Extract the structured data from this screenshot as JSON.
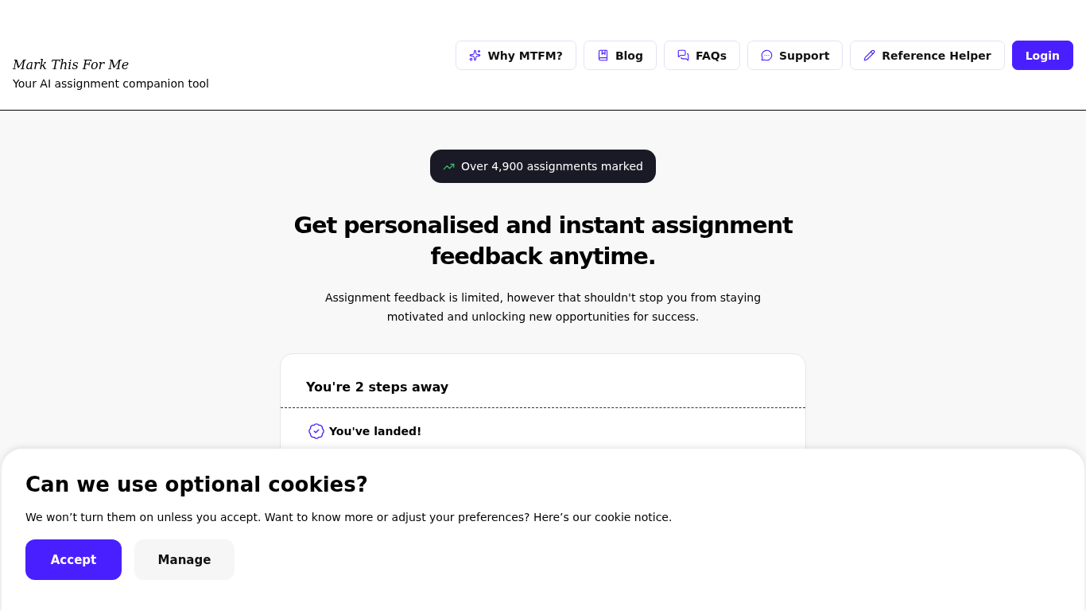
{
  "header": {
    "logo": "Mark This For Me",
    "tagline": "Your AI assignment companion tool"
  },
  "nav": [
    {
      "label": "Why MTFM?",
      "kind": "sparkle"
    },
    {
      "label": "Blog",
      "kind": "book"
    },
    {
      "label": "FAQs",
      "kind": "chats"
    },
    {
      "label": "Support",
      "kind": "message"
    },
    {
      "label": "Reference Helper",
      "kind": "pencil"
    },
    {
      "label": "Login",
      "kind": "primary"
    }
  ],
  "hero": {
    "badge": "Over 4,900 assignments marked",
    "title": "Get personalised and instant assignment feedback anytime.",
    "subtitle": "Assignment feedback is limited, however that shouldn't stop you from staying motivated and unlocking new opportunities for success."
  },
  "steps_card": {
    "title": "You're 2 steps away",
    "steps": [
      {
        "label": "You've landed!",
        "checked": true
      }
    ]
  },
  "cookie_banner": {
    "title": "Can we use optional cookies?",
    "text": "We won’t turn them on unless you accept. Want to know more or adjust your preferences? Here’s our cookie notice.",
    "buttons": [
      {
        "label": "Accept",
        "kind": "primary"
      },
      {
        "label": "Manage",
        "kind": "secondary"
      }
    ]
  }
}
